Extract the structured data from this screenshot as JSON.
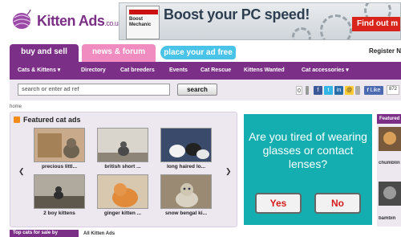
{
  "logo": {
    "text": "Kitten Ads",
    "suffix": ".co.uk"
  },
  "banner": {
    "box_brand": "Boost Mechanic",
    "headline": "Boost your PC speed!",
    "cta": "Find out m"
  },
  "tabs": [
    {
      "label": "buy and sell"
    },
    {
      "label": "news & forum"
    },
    {
      "label": "place your ad free"
    }
  ],
  "register": "Register N",
  "nav": [
    {
      "label": "Cats & Kittens ▾"
    },
    {
      "label": "Directory"
    },
    {
      "label": "Cat breeders"
    },
    {
      "label": "Events"
    },
    {
      "label": "Cat Rescue"
    },
    {
      "label": "Kittens Wanted"
    },
    {
      "label": "Cat accessories ▾"
    }
  ],
  "search": {
    "placeholder": "search or enter ad ref",
    "button": "search"
  },
  "social": {
    "count_box": "0",
    "like": "Like",
    "like_count": "872"
  },
  "breadcrumb": "home",
  "featured": {
    "title": "Featured cat ads",
    "items": [
      {
        "label": "precious littl..."
      },
      {
        "label": "british short ..."
      },
      {
        "label": "long haired lo..."
      },
      {
        "label": "2 boy kittens"
      },
      {
        "label": "ginger kitten ..."
      },
      {
        "label": "snow bengal ki..."
      }
    ]
  },
  "ad": {
    "question": "Are you tired of wearing glasses or contact lenses?",
    "yes": "Yes",
    "no": "No"
  },
  "right_sidebar": {
    "title": "Featured",
    "items": [
      {
        "label": "chumblin"
      },
      {
        "label": "bambin"
      }
    ]
  },
  "bottom": {
    "left_title": "Top cats for sale by",
    "mid_title": "All Kitten Ads"
  },
  "colors": {
    "brand_purple": "#7b2f86",
    "pink_tab": "#f18cc0",
    "blue_tab": "#49c4e8",
    "ad_teal": "#14aeb0"
  }
}
